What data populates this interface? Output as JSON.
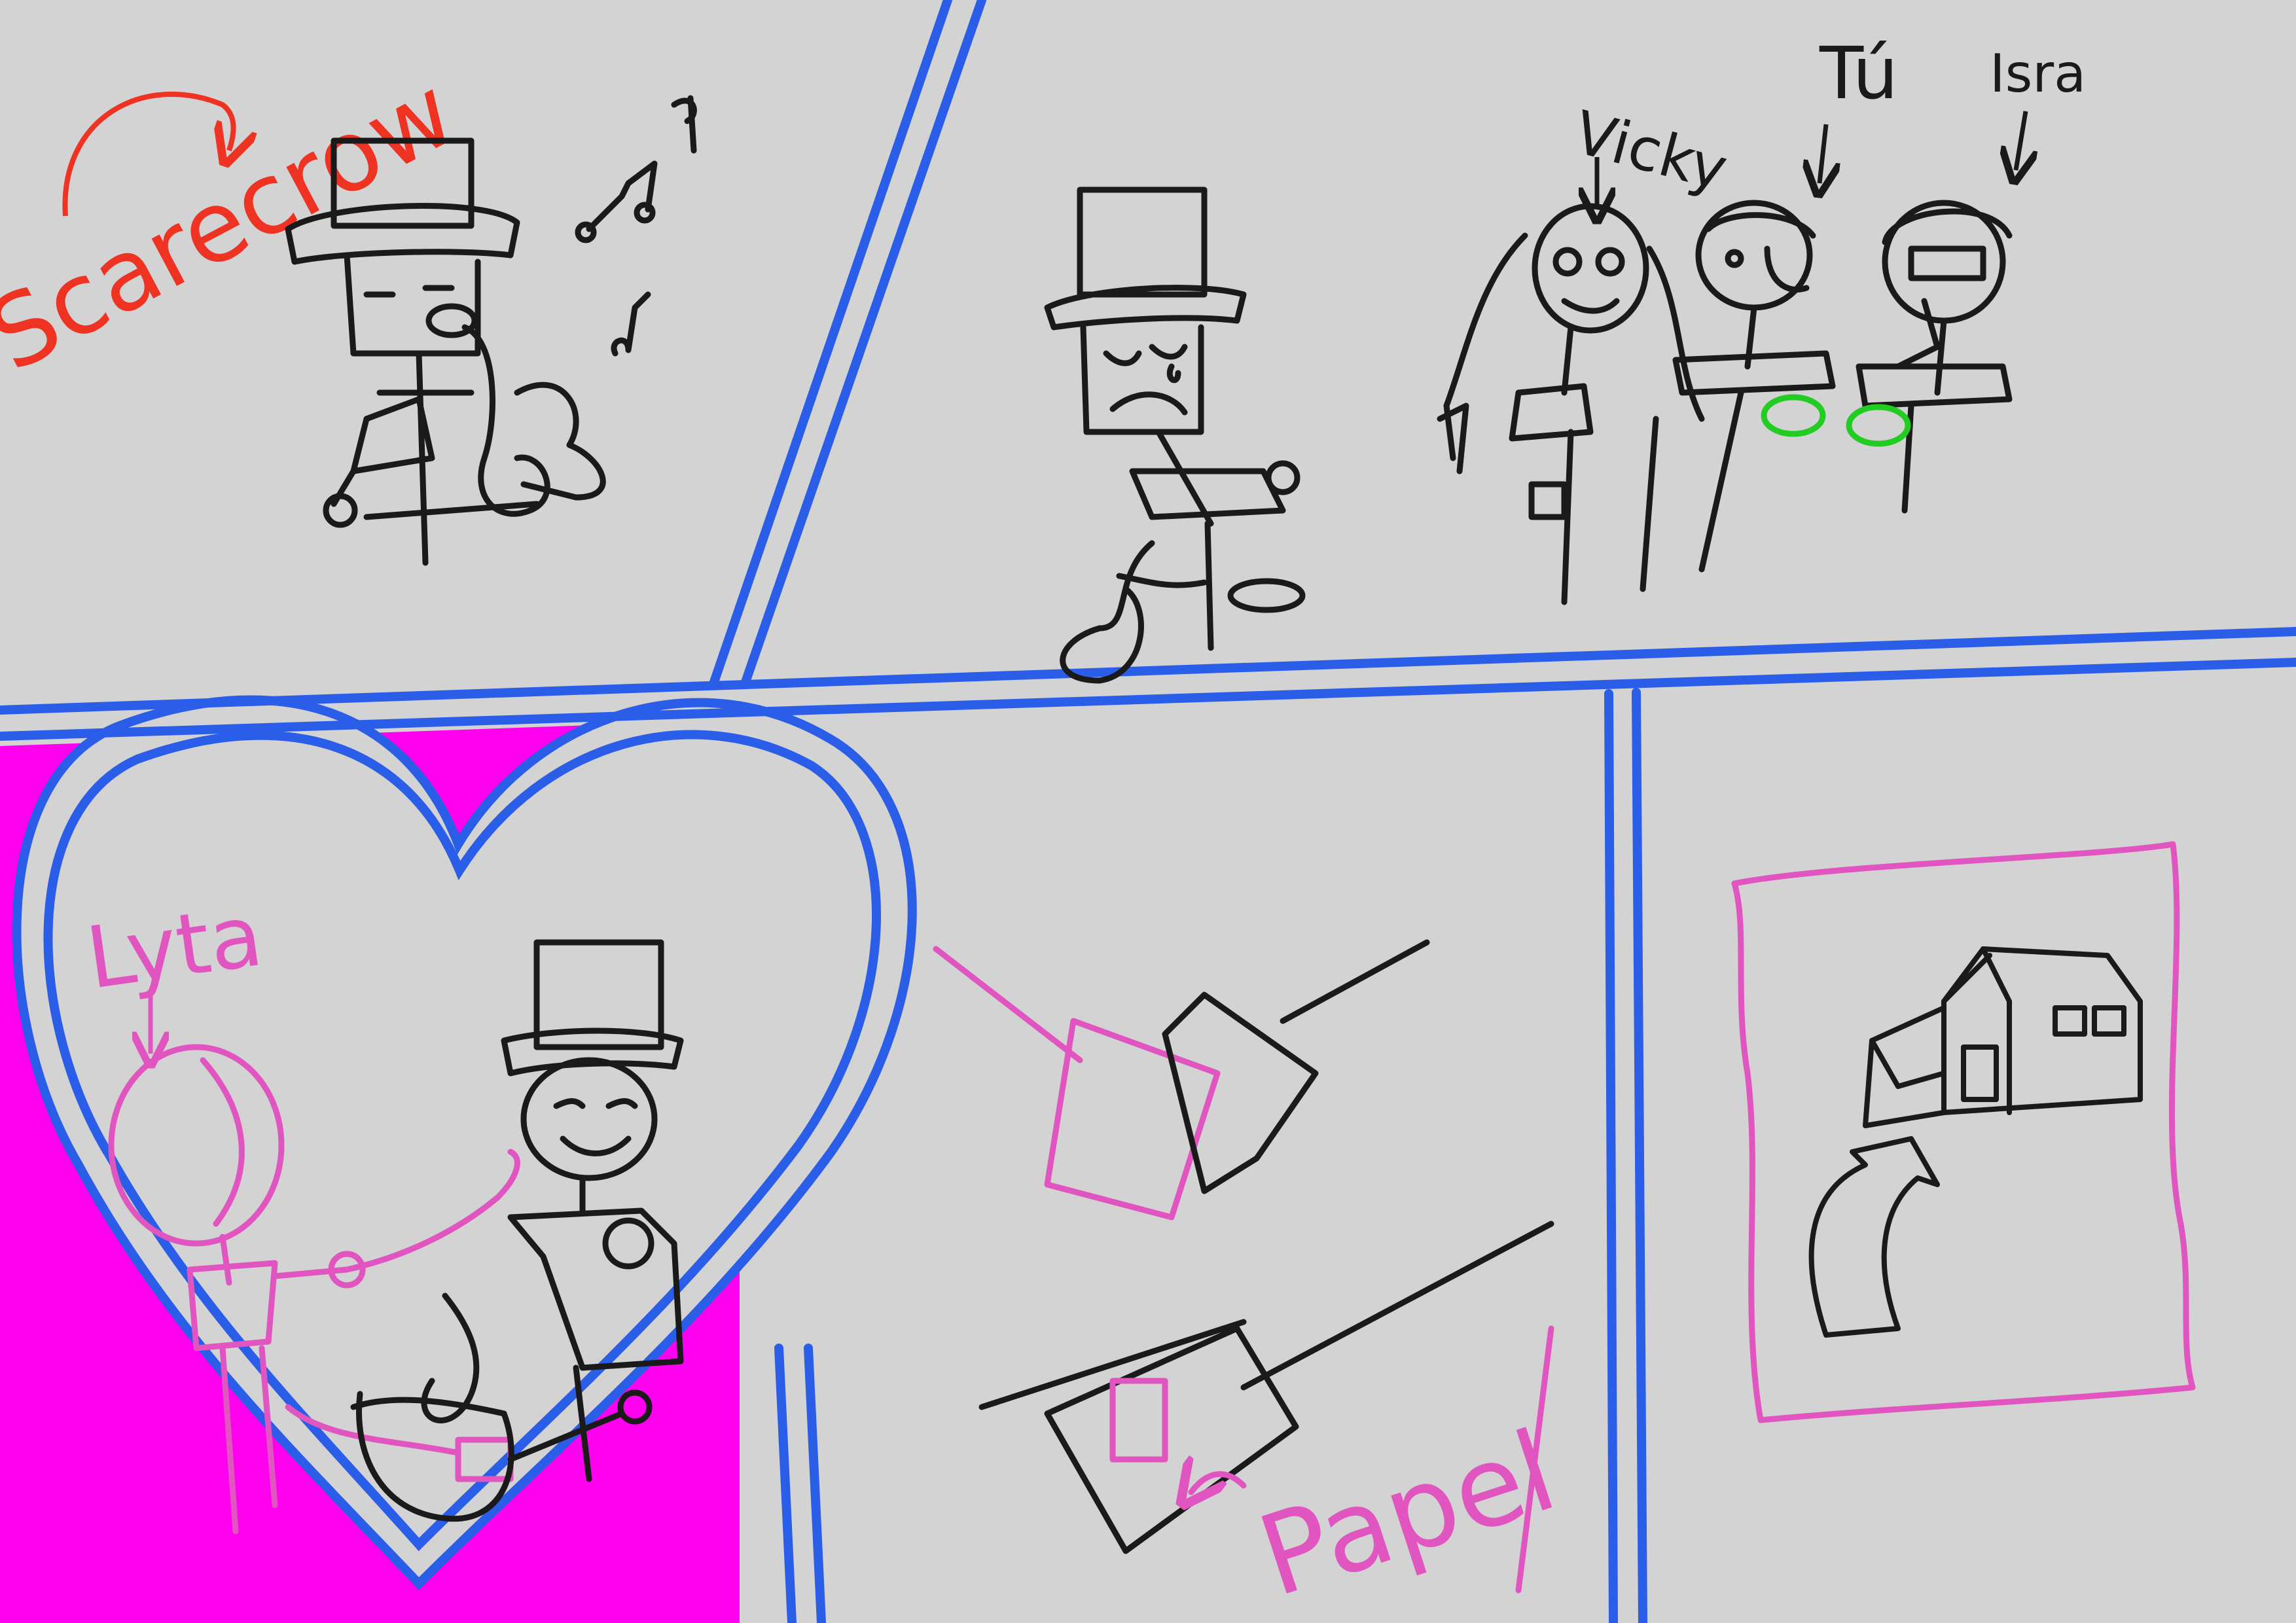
{
  "colors": {
    "background": "#d3d3d3",
    "panel_border": "#2a5de8",
    "ink": "#1a1a1a",
    "label_red": "#ee3322",
    "label_pink": "#e055c0",
    "highlight_magenta": "#ff00ee",
    "mask_green": "#22cc22"
  },
  "labels": {
    "scarecrow": "Scarecrow",
    "vicky": "Vicky",
    "tu": "Tú",
    "isra": "Isra",
    "lyta": "Lyta",
    "papel": "Papel"
  }
}
